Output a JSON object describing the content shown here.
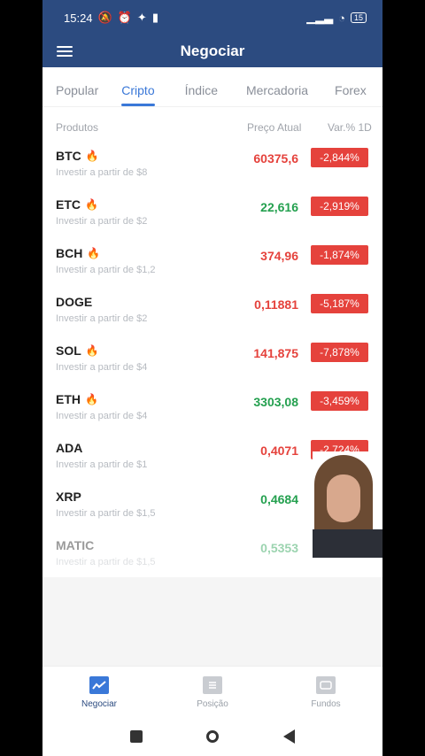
{
  "status": {
    "time": "15:24",
    "battery": "15"
  },
  "header": {
    "title": "Negociar"
  },
  "tabs": [
    {
      "label": "Popular"
    },
    {
      "label": "Cripto"
    },
    {
      "label": "Índice"
    },
    {
      "label": "Mercadoria"
    },
    {
      "label": "Forex"
    }
  ],
  "columns": {
    "product": "Produtos",
    "price": "Preço Atual",
    "var": "Var.% 1D"
  },
  "rows": [
    {
      "symbol": "BTC",
      "hot": true,
      "sub": "Investir a partir de $8",
      "price": "60375,6",
      "trend": "red",
      "var": "-2,844%"
    },
    {
      "symbol": "ETC",
      "hot": true,
      "sub": "Investir a partir de $2",
      "price": "22,616",
      "trend": "green",
      "var": "-2,919%"
    },
    {
      "symbol": "BCH",
      "hot": true,
      "sub": "Investir a partir de $1,2",
      "price": "374,96",
      "trend": "red",
      "var": "-1,874%"
    },
    {
      "symbol": "DOGE",
      "hot": false,
      "sub": "Investir a partir de $2",
      "price": "0,11881",
      "trend": "red",
      "var": "-5,187%"
    },
    {
      "symbol": "SOL",
      "hot": true,
      "sub": "Investir a partir de $4",
      "price": "141,875",
      "trend": "red",
      "var": "-7,878%"
    },
    {
      "symbol": "ETH",
      "hot": true,
      "sub": "Investir a partir de $4",
      "price": "3303,08",
      "trend": "green",
      "var": "-3,459%"
    },
    {
      "symbol": "ADA",
      "hot": false,
      "sub": "Investir a partir de $1",
      "price": "0,4071",
      "trend": "red",
      "var": "-2,724%"
    },
    {
      "symbol": "XRP",
      "hot": false,
      "sub": "Investir a partir de $1,5",
      "price": "0,4684",
      "trend": "green",
      "var": ""
    },
    {
      "symbol": "MATIC",
      "hot": false,
      "sub": "Investir a partir de $1,5",
      "price": "0,5353",
      "trend": "green",
      "var": ""
    }
  ],
  "bottom_nav": [
    {
      "label": "Negociar",
      "icon": "chart-icon"
    },
    {
      "label": "Posição",
      "icon": "document-icon"
    },
    {
      "label": "Fundos",
      "icon": "wallet-icon"
    }
  ],
  "colors": {
    "primary": "#2c4b80",
    "accent": "#3a78d8",
    "down": "#e5423c",
    "up": "#24a04f"
  }
}
